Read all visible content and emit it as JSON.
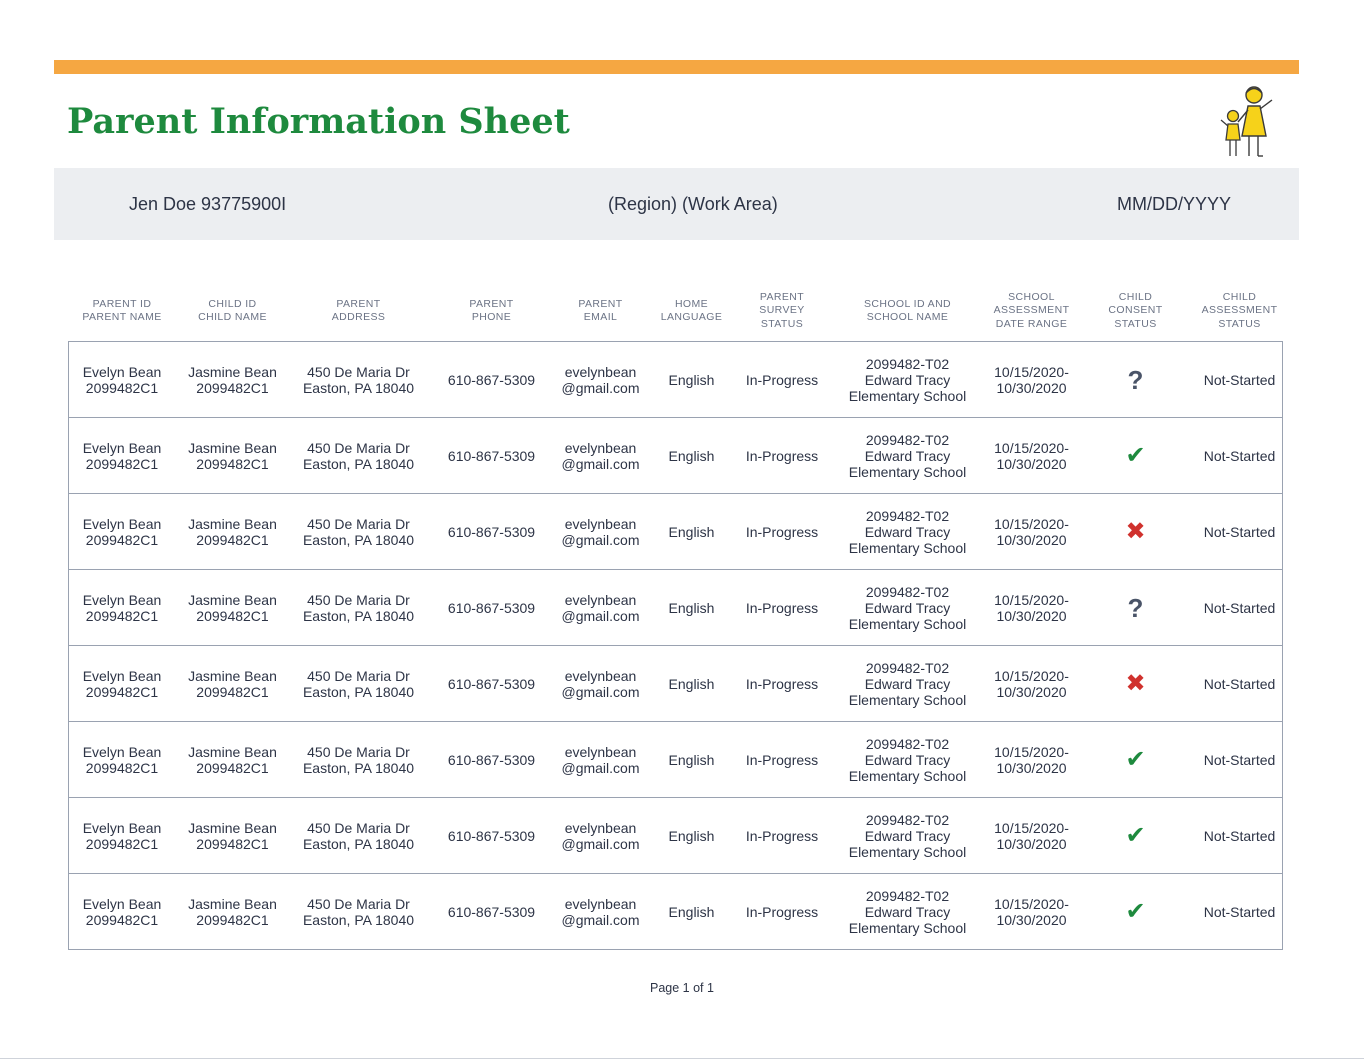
{
  "header": {
    "title": "Parent Information Sheet",
    "accent_color": "#f5a742",
    "title_color": "#1e8a3e",
    "mascot_icon": "parent-and-child-icon"
  },
  "info_bar": {
    "name": "Jen Doe 93775900I",
    "region": "(Region)  (Work Area)",
    "date": "MM/DD/YYYY"
  },
  "table": {
    "columns": [
      "PARENT ID\nPARENT NAME",
      "CHILD ID\nCHILD NAME",
      "PARENT\nADDRESS",
      "PARENT\nPHONE",
      "PARENT\nEMAIL",
      "HOME\nLANGUAGE",
      "PARENT SURVEY\nSTATUS",
      "SCHOOL ID AND\nSCHOOL NAME",
      "SCHOOL\nASSESSMENT\nDATE RANGE",
      "CHILD\nCONSENT\nSTATUS",
      "CHILD\nASSESSMENT\nSTATUS"
    ],
    "rows": [
      {
        "parent_name": "Evelyn Bean",
        "parent_id": "2099482C1",
        "child_name": "Jasmine Bean",
        "child_id": "2099482C1",
        "address_1": "450 De Maria Dr",
        "address_2": "Easton, PA 18040",
        "phone": "610-867-5309",
        "email_1": "evelynbean",
        "email_2": "@gmail.com",
        "language": "English",
        "survey_status": "In-Progress",
        "school_id": "2099482-T02",
        "school_name_1": "Edward Tracy",
        "school_name_2": "Elementary School",
        "date_start": "10/15/2020-",
        "date_end": "10/30/2020",
        "consent": "unknown",
        "consent_icon": "question-icon",
        "assessment_status": "Not-Started"
      },
      {
        "parent_name": "Evelyn Bean",
        "parent_id": "2099482C1",
        "child_name": "Jasmine Bean",
        "child_id": "2099482C1",
        "address_1": "450 De Maria Dr",
        "address_2": "Easton, PA 18040",
        "phone": "610-867-5309",
        "email_1": "evelynbean",
        "email_2": "@gmail.com",
        "language": "English",
        "survey_status": "In-Progress",
        "school_id": "2099482-T02",
        "school_name_1": "Edward Tracy",
        "school_name_2": "Elementary School",
        "date_start": "10/15/2020-",
        "date_end": "10/30/2020",
        "consent": "granted",
        "consent_icon": "check-icon",
        "assessment_status": "Not-Started"
      },
      {
        "parent_name": "Evelyn Bean",
        "parent_id": "2099482C1",
        "child_name": "Jasmine Bean",
        "child_id": "2099482C1",
        "address_1": "450 De Maria Dr",
        "address_2": "Easton, PA 18040",
        "phone": "610-867-5309",
        "email_1": "evelynbean",
        "email_2": "@gmail.com",
        "language": "English",
        "survey_status": "In-Progress",
        "school_id": "2099482-T02",
        "school_name_1": "Edward Tracy",
        "school_name_2": "Elementary School",
        "date_start": "10/15/2020-",
        "date_end": "10/30/2020",
        "consent": "denied",
        "consent_icon": "x-icon",
        "assessment_status": "Not-Started"
      },
      {
        "parent_name": "Evelyn Bean",
        "parent_id": "2099482C1",
        "child_name": "Jasmine Bean",
        "child_id": "2099482C1",
        "address_1": "450 De Maria Dr",
        "address_2": "Easton, PA 18040",
        "phone": "610-867-5309",
        "email_1": "evelynbean",
        "email_2": "@gmail.com",
        "language": "English",
        "survey_status": "In-Progress",
        "school_id": "2099482-T02",
        "school_name_1": "Edward Tracy",
        "school_name_2": "Elementary School",
        "date_start": "10/15/2020-",
        "date_end": "10/30/2020",
        "consent": "unknown",
        "consent_icon": "question-icon",
        "assessment_status": "Not-Started"
      },
      {
        "parent_name": "Evelyn Bean",
        "parent_id": "2099482C1",
        "child_name": "Jasmine Bean",
        "child_id": "2099482C1",
        "address_1": "450 De Maria Dr",
        "address_2": "Easton, PA 18040",
        "phone": "610-867-5309",
        "email_1": "evelynbean",
        "email_2": "@gmail.com",
        "language": "English",
        "survey_status": "In-Progress",
        "school_id": "2099482-T02",
        "school_name_1": "Edward Tracy",
        "school_name_2": "Elementary School",
        "date_start": "10/15/2020-",
        "date_end": "10/30/2020",
        "consent": "denied",
        "consent_icon": "x-icon",
        "assessment_status": "Not-Started"
      },
      {
        "parent_name": "Evelyn Bean",
        "parent_id": "2099482C1",
        "child_name": "Jasmine Bean",
        "child_id": "2099482C1",
        "address_1": "450 De Maria Dr",
        "address_2": "Easton, PA 18040",
        "phone": "610-867-5309",
        "email_1": "evelynbean",
        "email_2": "@gmail.com",
        "language": "English",
        "survey_status": "In-Progress",
        "school_id": "2099482-T02",
        "school_name_1": "Edward Tracy",
        "school_name_2": "Elementary School",
        "date_start": "10/15/2020-",
        "date_end": "10/30/2020",
        "consent": "granted",
        "consent_icon": "check-icon",
        "assessment_status": "Not-Started"
      },
      {
        "parent_name": "Evelyn Bean",
        "parent_id": "2099482C1",
        "child_name": "Jasmine Bean",
        "child_id": "2099482C1",
        "address_1": "450 De Maria Dr",
        "address_2": "Easton, PA 18040",
        "phone": "610-867-5309",
        "email_1": "evelynbean",
        "email_2": "@gmail.com",
        "language": "English",
        "survey_status": "In-Progress",
        "school_id": "2099482-T02",
        "school_name_1": "Edward Tracy",
        "school_name_2": "Elementary School",
        "date_start": "10/15/2020-",
        "date_end": "10/30/2020",
        "consent": "granted",
        "consent_icon": "check-icon",
        "assessment_status": "Not-Started"
      },
      {
        "parent_name": "Evelyn Bean",
        "parent_id": "2099482C1",
        "child_name": "Jasmine Bean",
        "child_id": "2099482C1",
        "address_1": "450 De Maria Dr",
        "address_2": "Easton, PA 18040",
        "phone": "610-867-5309",
        "email_1": "evelynbean",
        "email_2": "@gmail.com",
        "language": "English",
        "survey_status": "In-Progress",
        "school_id": "2099482-T02",
        "school_name_1": "Edward Tracy",
        "school_name_2": "Elementary School",
        "date_start": "10/15/2020-",
        "date_end": "10/30/2020",
        "consent": "granted",
        "consent_icon": "check-icon",
        "assessment_status": "Not-Started"
      }
    ]
  },
  "footer": {
    "page_label": "Page 1 of 1"
  }
}
